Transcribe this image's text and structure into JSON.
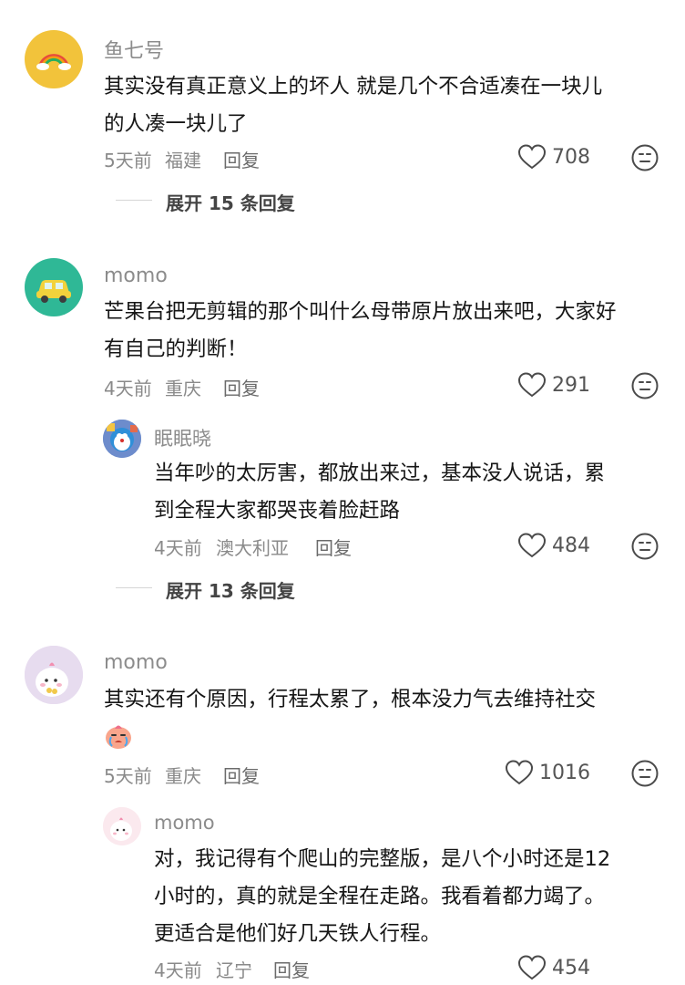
{
  "comments": [
    {
      "username": "鱼七号",
      "lines": [
        "其实没有真正意义上的坏人  就是几个不合适凑在一块儿",
        "的人凑一块儿了"
      ],
      "time": "5天前",
      "location": "福建",
      "reply_label": "回复",
      "likes": "708",
      "expand_label": "展开 15 条回复",
      "avatar_color": "#f2c33b"
    },
    {
      "username": "momo",
      "lines": [
        "芒果台把无剪辑的那个叫什么母带原片放出来吧，大家好",
        "有自己的判断！"
      ],
      "time": "4天前",
      "location": "重庆",
      "reply_label": "回复",
      "likes": "291",
      "avatar_color": "#2fb896",
      "replies": [
        {
          "username": "眠眠晓",
          "lines": [
            "当年吵的太厉害，都放出来过，基本没人说话，累",
            "到全程大家都哭丧着脸赶路"
          ],
          "time": "4天前",
          "location": "澳大利亚",
          "reply_label": "回复",
          "likes": "484"
        }
      ],
      "expand_label": "展开 13 条回复"
    },
    {
      "username": "momo",
      "lines": [
        "其实还有个原因，行程太累了，根本没力气去维持社交"
      ],
      "time": "5天前",
      "location": "重庆",
      "reply_label": "回复",
      "likes": "1016",
      "avatar_color": "#e7dcef",
      "replies": [
        {
          "username": "momo",
          "lines": [
            "对，我记得有个爬山的完整版，是八个小时还是12",
            "小时的，真的就是全程在走路。我看着都力竭了。",
            "更适合是他们好几天铁人行程。"
          ],
          "time": "4天前",
          "location": "辽宁",
          "reply_label": "回复",
          "likes": "454"
        }
      ]
    }
  ],
  "colors": {
    "username": "#8c8c8c",
    "meta": "#8a8a8a",
    "text": "#161616"
  }
}
